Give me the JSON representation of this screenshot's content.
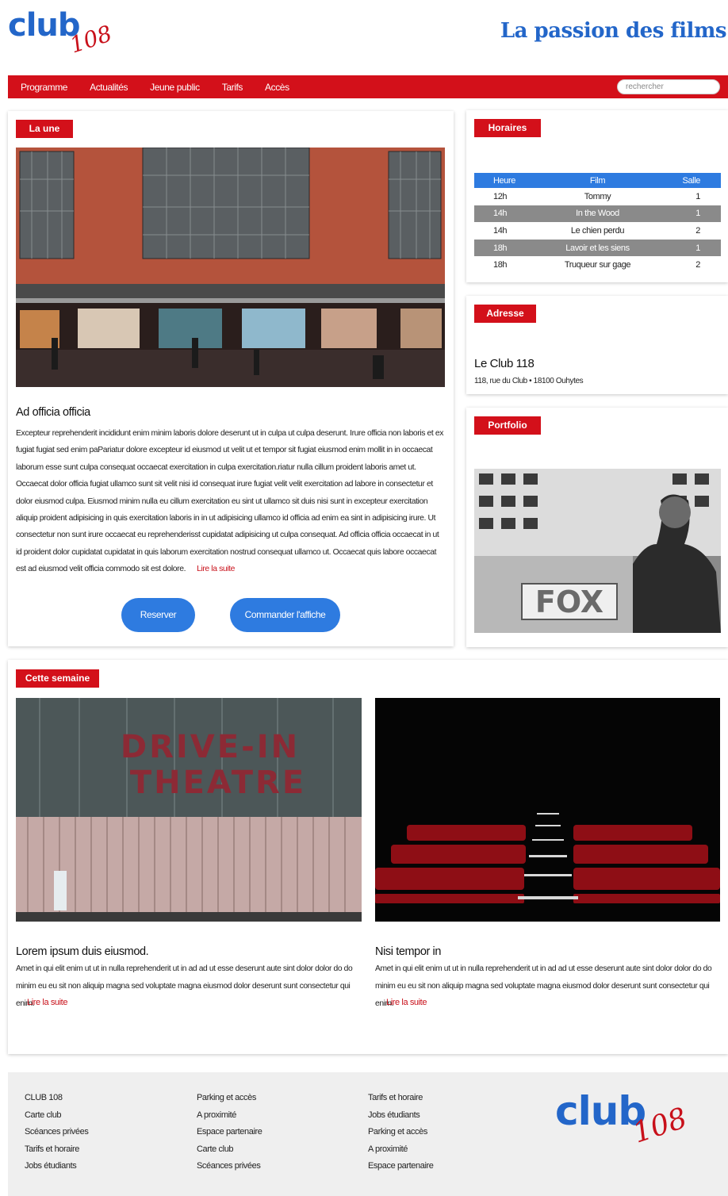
{
  "header": {
    "logo_text": "club",
    "logo_number": "108",
    "tagline": "La passion des films"
  },
  "nav": {
    "items": [
      "Programme",
      "Actualités",
      "Jeune public",
      "Tarifs",
      "Accès"
    ],
    "search_placeholder": "rechercher"
  },
  "colors": {
    "brand_red": "#d3101a",
    "brand_blue": "#2366c9",
    "button_blue": "#2e7be0"
  },
  "une": {
    "label": "La une",
    "image": "cinema-facade-photo",
    "title": "Ad officia officia",
    "text": "Excepteur reprehenderit incididunt enim minim laboris dolore deserunt ut in culpa ut culpa deserunt. Irure officia non laboris et ex fugiat fugiat sed enim paPariatur dolore excepteur id eiusmod ut velit ut et tempor sit fugiat eiusmod enim mollit in in occaecat laborum esse sunt culpa consequat occaecat exercitation in culpa exercitation.riatur nulla cillum proident laboris amet ut. Occaecat dolor officia fugiat ullamco sunt sit velit nisi id consequat irure fugiat velit velit exercitation ad labore in consectetur et dolor eiusmod culpa. Eiusmod minim nulla eu cillum exercitation eu sint ut ullamco sit duis nisi sunt in excepteur exercitation aliquip proident adipisicing in quis exercitation laboris in in ut adipisicing ullamco id officia ad enim ea sint in adipisicing irure. Ut consectetur non sunt irure occaecat eu reprehenderisst cupidatat adipisicing ut culpa consequat. Ad officia officia occaecat in ut id proident dolor cupidatat cupidatat in quis laborum exercitation nostrud consequat ullamco ut. Occaecat quis labore occaecat est ad eiusmod velit officia commodo sit est dolore.",
    "read_more": "Lire la suite",
    "btn_reserve": "Reserver",
    "btn_poster": "Commander l'affiche"
  },
  "horaires": {
    "label": "Horaires",
    "columns": [
      "Heure",
      "Film",
      "Salle"
    ],
    "rows": [
      {
        "time": "12h",
        "film": "Tommy",
        "room": "1"
      },
      {
        "time": "14h",
        "film": "In the Wood",
        "room": "1"
      },
      {
        "time": "14h",
        "film": "Le chien perdu",
        "room": "2"
      },
      {
        "time": "18h",
        "film": "Lavoir et les siens",
        "room": "1"
      },
      {
        "time": "18h",
        "film": "Truqueur sur gage",
        "room": "2"
      }
    ]
  },
  "adresse": {
    "label": "Adresse",
    "name": "Le Club 118",
    "line": "118, rue du Club • 18100 Ouhytes"
  },
  "portfolio": {
    "label": "Portfolio",
    "image": "fox-theatre-man-photo"
  },
  "semaine": {
    "label": "Cette semaine",
    "items": [
      {
        "image": "drive-in-theatre-photo",
        "image_text": "DRIVE-IN THEATRE",
        "title": "Lorem ipsum duis eiusmod.",
        "text": "Amet in qui elit enim ut ut in nulla reprehenderit ut in ad ad ut esse deserunt aute sint dolor dolor do do minim eu eu sit non aliquip magna sed voluptate magna eiusmod dolor deserunt sunt consectetur qui enim.",
        "read_more": "Lire la suite"
      },
      {
        "image": "cinema-seats-photo",
        "title": "Nisi tempor in",
        "text": "Amet in qui elit enim ut ut in nulla reprehenderit ut in ad ad ut esse deserunt aute sint dolor dolor do do minim eu eu sit non aliquip magna sed voluptate magna eiusmod dolor deserunt sunt consectetur qui enim.",
        "read_more": "Lire la suite"
      }
    ]
  },
  "footer": {
    "col1": [
      "CLUB 108",
      "Carte club",
      "Scéances privées",
      "Tarifs et horaire",
      "Jobs étudiants"
    ],
    "col2": [
      "Parking et accès",
      "A proximité",
      "Espace partenaire",
      "Carte club",
      "Scéances privées"
    ],
    "col3": [
      "Tarifs et horaire",
      "Jobs étudiants",
      "Parking et accès",
      "A proximité",
      "Espace partenaire"
    ],
    "logo_text": "club",
    "logo_number": "108"
  }
}
